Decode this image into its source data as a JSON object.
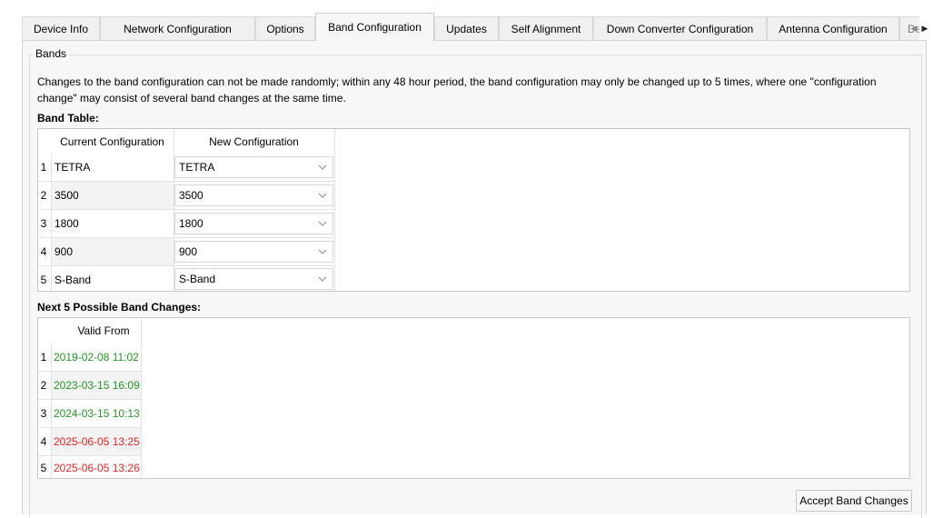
{
  "tabs": [
    {
      "label": "Device Info"
    },
    {
      "label": "Network Configuration"
    },
    {
      "label": "Options"
    },
    {
      "label": "Band Configuration"
    },
    {
      "label": "Updates"
    },
    {
      "label": "Self Alignment"
    },
    {
      "label": "Down Converter Configuration"
    },
    {
      "label": "Antenna Configuration"
    },
    {
      "label": "De"
    }
  ],
  "active_tab": "Band Configuration",
  "group": {
    "title": "Bands",
    "info": "Changes to the band configuration can not be made randomly; within any 48 hour period, the band configuration may only be changed up to 5 times, where one \"configuration change\" may consist of several band changes at the same time."
  },
  "band_table": {
    "label": "Band Table:",
    "headers": [
      "Current Configuration",
      "New Configuration"
    ],
    "rows": [
      {
        "num": "1",
        "current": "TETRA",
        "new": "TETRA"
      },
      {
        "num": "2",
        "current": "3500",
        "new": "3500"
      },
      {
        "num": "3",
        "current": "1800",
        "new": "1800"
      },
      {
        "num": "4",
        "current": "900",
        "new": "900"
      },
      {
        "num": "5",
        "current": "S-Band",
        "new": "S-Band"
      }
    ]
  },
  "changes_table": {
    "label": "Next 5 Possible Band Changes:",
    "header": "Valid From",
    "rows": [
      {
        "num": "1",
        "valid_from": "2019-02-08 11:02",
        "status": "green"
      },
      {
        "num": "2",
        "valid_from": "2023-03-15 16:09",
        "status": "green"
      },
      {
        "num": "3",
        "valid_from": "2024-03-15 10:13",
        "status": "green"
      },
      {
        "num": "4",
        "valid_from": "2025-06-05 13:25",
        "status": "red"
      },
      {
        "num": "5",
        "valid_from": "2025-06-05 13:26",
        "status": "red"
      }
    ]
  },
  "accept_button": {
    "label": "Accept Band Changes"
  },
  "icons": {
    "combo_arrow": "chevron-down-icon",
    "tab_left": "triangle-left-icon",
    "tab_right": "triangle-right-icon"
  },
  "colors": {
    "valid_green": "#1f9a1f",
    "invalid_red": "#ee2222",
    "panel_bg": "#f7f7f7"
  }
}
